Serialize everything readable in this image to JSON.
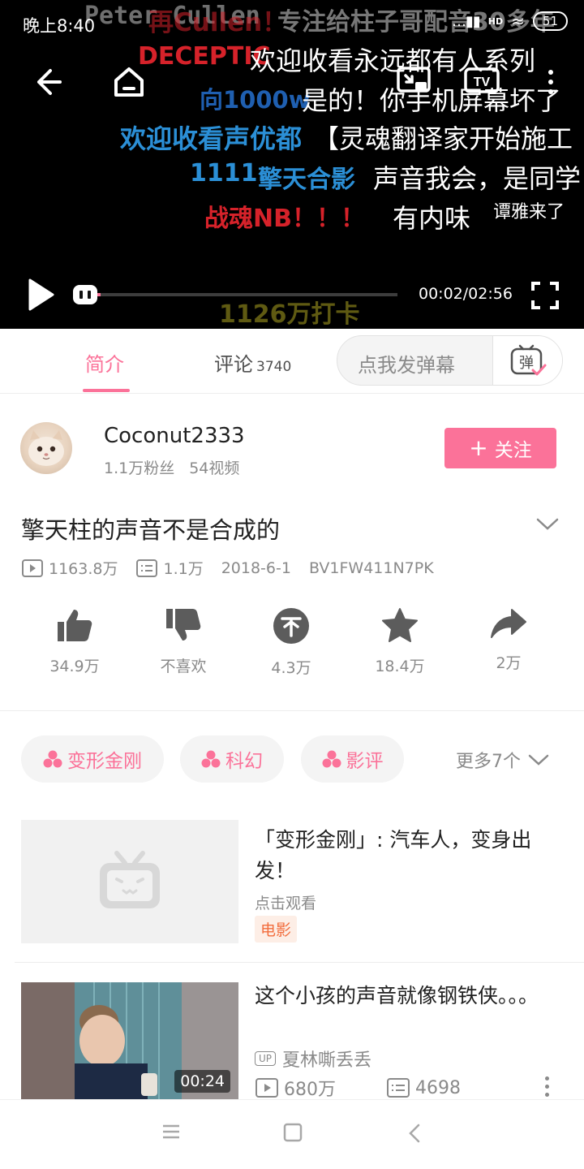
{
  "status_bar": {
    "time": "晚上8:40",
    "network": "HD",
    "battery": "51"
  },
  "player": {
    "danmaku": [
      "Peter Cullen",
      "再Cullen！",
      "专注给柱子哥配音30多年",
      "DECEPTIC",
      "欢迎收看永远都有人系列",
      "向1000w",
      "是的！你手机屏幕坏了",
      "欢迎收看声优都",
      "【灵魂翻译家开始施工",
      "1111.",
      "擎天合影",
      "声音我会，是同学",
      "战魂NB！！！",
      "有内味",
      "谭雅来了",
      "1126万打卡"
    ],
    "current_time": "00:02",
    "total_time": "02:56",
    "time_display": "00:02/02:56",
    "progress": 0.011
  },
  "tabs": {
    "intro": "简介",
    "comments": "评论",
    "comment_count": "3740",
    "danmaku_placeholder": "点我发弹幕",
    "danmaku_button": "弹"
  },
  "uploader": {
    "name": "Coconut2333",
    "fans": "1.1万粉丝",
    "videos": "54视频",
    "follow_label": "关注"
  },
  "video": {
    "title": "擎天柱的声音不是合成的",
    "views": "1163.8万",
    "danmaku_count": "1.1万",
    "date": "2018-6-1",
    "bvid": "BV1FW411N7PK"
  },
  "actions": {
    "like": "34.9万",
    "dislike": "不喜欢",
    "coin": "4.3万",
    "favorite": "18.4万",
    "share": "2万"
  },
  "tags": [
    "变形金刚",
    "科幻",
    "影评"
  ],
  "more_tags": "更多7个",
  "related": [
    {
      "title": "「变形金刚」: 汽车人，变身出发！",
      "subtitle": "点击观看",
      "badge": "电影"
    },
    {
      "title": "这个小孩的声音就像钢铁侠。。。",
      "uploader": "夏林嘶丢丢",
      "up_badge": "UP",
      "duration": "00:24",
      "views": "680万",
      "danmaku": "4698"
    }
  ],
  "colors": {
    "accent": "#fb7299",
    "danmaku_red": "#d6222a",
    "danmaku_blue": "#2b8fd6",
    "movie_badge": "#f26d3d"
  },
  "icons": [
    "back-icon",
    "home-icon",
    "cast-icon",
    "tv-icon",
    "more-icon",
    "play-icon",
    "danmaku-toggle-icon",
    "fullscreen-icon",
    "like-icon",
    "dislike-icon",
    "coin-icon",
    "star-icon",
    "share-icon",
    "tag-icon",
    "chevron-down-icon",
    "bilibili-tv-icon",
    "play-count-icon",
    "danmaku-count-icon",
    "menu-icon",
    "square-icon",
    "back-nav-icon"
  ]
}
